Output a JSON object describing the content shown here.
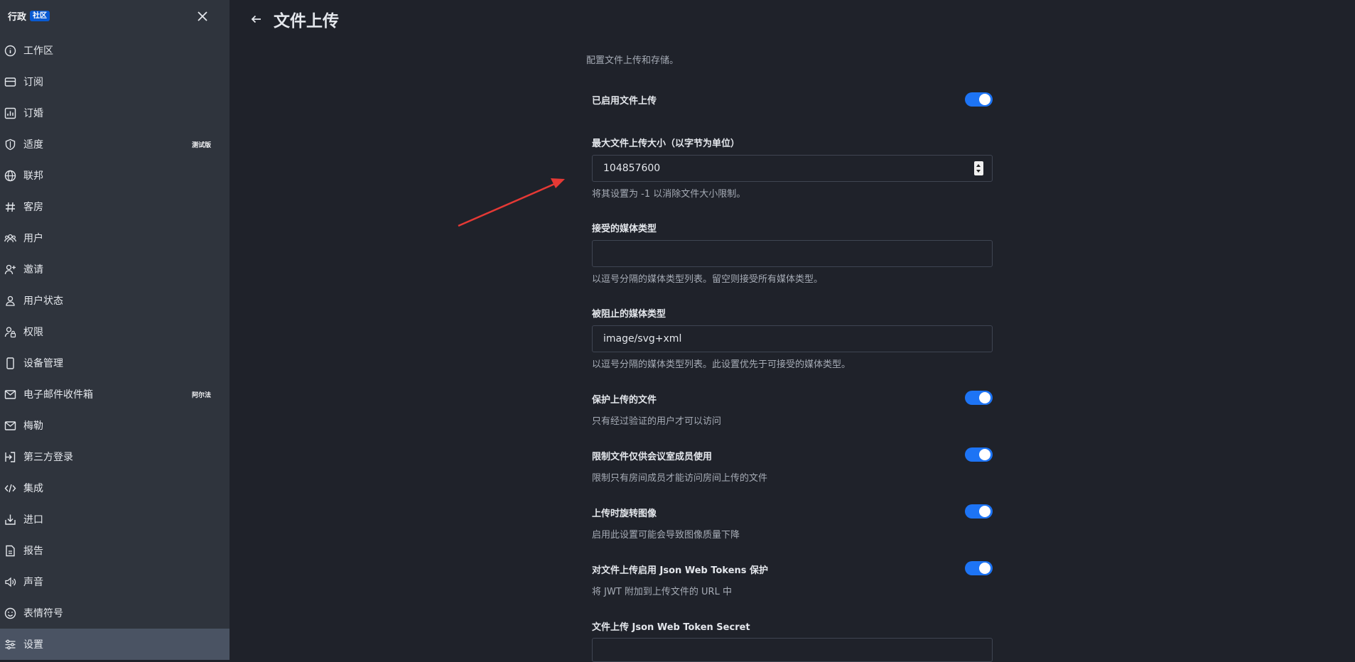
{
  "sidebar": {
    "title": "行政",
    "badge": "社区",
    "items": [
      {
        "label": "工作区",
        "icon": "info-icon"
      },
      {
        "label": "订阅",
        "icon": "card-icon"
      },
      {
        "label": "订婚",
        "icon": "chart-icon"
      },
      {
        "label": "适度",
        "icon": "shield-icon",
        "tag": "测试版"
      },
      {
        "label": "联邦",
        "icon": "globe-icon"
      },
      {
        "label": "客房",
        "icon": "hash-icon"
      },
      {
        "label": "用户",
        "icon": "team-icon"
      },
      {
        "label": "邀请",
        "icon": "user-plus-icon"
      },
      {
        "label": "用户状态",
        "icon": "user-icon"
      },
      {
        "label": "权限",
        "icon": "user-lock-icon"
      },
      {
        "label": "设备管理",
        "icon": "mobile-icon"
      },
      {
        "label": "电子邮件收件箱",
        "icon": "mail-icon",
        "tag": "阿尔法"
      },
      {
        "label": "梅勒",
        "icon": "mail-icon"
      },
      {
        "label": "第三方登录",
        "icon": "login-icon"
      },
      {
        "label": "集成",
        "icon": "code-icon"
      },
      {
        "label": "进口",
        "icon": "import-icon"
      },
      {
        "label": "报告",
        "icon": "file-icon"
      },
      {
        "label": "声音",
        "icon": "volume-icon"
      },
      {
        "label": "表情符号",
        "icon": "emoji-icon"
      },
      {
        "label": "设置",
        "icon": "sliders-icon",
        "active": true
      }
    ]
  },
  "main": {
    "title": "文件上传",
    "description": "配置文件上传和存储。",
    "settings": {
      "enabled": {
        "label": "已启用文件上传",
        "value": true
      },
      "max_size": {
        "label": "最大文件上传大小（以字节为单位）",
        "value": "104857600",
        "hint": "将其设置为 -1 以消除文件大小限制。"
      },
      "accepted": {
        "label": "接受的媒体类型",
        "value": "",
        "hint": "以逗号分隔的媒体类型列表。留空则接受所有媒体类型。"
      },
      "blocked": {
        "label": "被阻止的媒体类型",
        "value": "image/svg+xml",
        "hint": "以逗号分隔的媒体类型列表。此设置优先于可接受的媒体类型。"
      },
      "protect": {
        "label": "保护上传的文件",
        "hint": "只有经过验证的用户才可以访问",
        "value": true
      },
      "restrict_room": {
        "label": "限制文件仅供会议室成员使用",
        "hint": "限制只有房间成员才能访问房间上传的文件",
        "value": true
      },
      "rotate": {
        "label": "上传时旋转图像",
        "hint": "启用此设置可能会导致图像质量下降",
        "value": true
      },
      "jwt": {
        "label": "对文件上传启用 Json Web Tokens 保护",
        "hint": "将 JWT 附加到上传文件的 URL 中",
        "value": true
      },
      "jwt_secret": {
        "label": "文件上传 Json Web Token Secret",
        "value": ""
      }
    }
  },
  "colors": {
    "toggle_on": "#1d74f5",
    "annotation_arrow": "#e53935",
    "badge": "#095ad2"
  }
}
